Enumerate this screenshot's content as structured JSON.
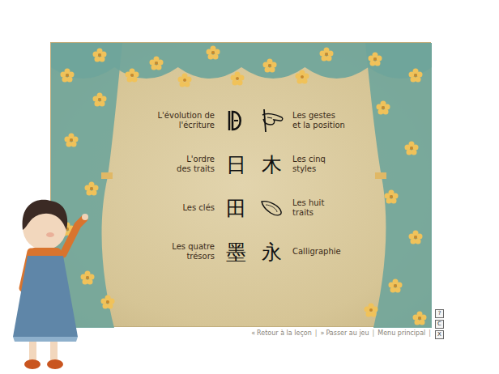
{
  "menu": {
    "left": [
      {
        "label": [
          "L'évolution de",
          "l'écriture"
        ],
        "kind": "archaic",
        "char": ""
      },
      {
        "label": [
          "L'ordre",
          "des traits"
        ],
        "kind": "char",
        "char": "日"
      },
      {
        "label": [
          "Les clés"
        ],
        "kind": "char",
        "char": "田"
      },
      {
        "label": [
          "Les quatre",
          "trésors"
        ],
        "kind": "char",
        "char": "墨"
      }
    ],
    "right": [
      {
        "label": [
          "Les gestes",
          "et la position"
        ],
        "kind": "hand",
        "char": ""
      },
      {
        "label": [
          "Les cinq",
          "styles"
        ],
        "kind": "char",
        "char": "木"
      },
      {
        "label": [
          "Les huit",
          "traits"
        ],
        "kind": "stroke",
        "char": ""
      },
      {
        "label": [
          "Calligraphie"
        ],
        "kind": "char",
        "char": "永"
      }
    ]
  },
  "nav": [
    {
      "arrow": "«",
      "label": "Retour à la leçon"
    },
    {
      "arrow": "»",
      "label": "Passer au jeu"
    },
    {
      "arrow": "",
      "label": "Menu principal"
    }
  ],
  "separator": "|",
  "corner_buttons": [
    "?",
    "C",
    "X"
  ]
}
